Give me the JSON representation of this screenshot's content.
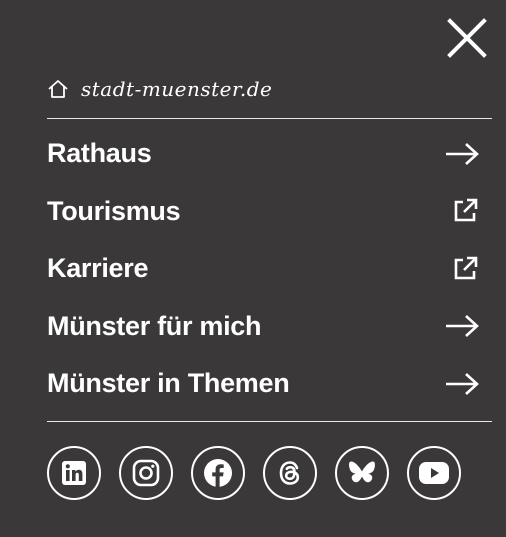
{
  "header": {
    "home_label": "stadt-muenster.de",
    "close_icon": "close-icon"
  },
  "nav": {
    "items": [
      {
        "label": "Rathaus",
        "icon": "arrow-right-icon"
      },
      {
        "label": "Tourismus",
        "icon": "external-link-icon"
      },
      {
        "label": "Karriere",
        "icon": "external-link-icon"
      },
      {
        "label": "Münster für mich",
        "icon": "arrow-right-icon"
      },
      {
        "label": "Münster in Themen",
        "icon": "arrow-right-icon"
      }
    ]
  },
  "social": {
    "items": [
      {
        "icon": "linkedin-icon"
      },
      {
        "icon": "instagram-icon"
      },
      {
        "icon": "facebook-icon"
      },
      {
        "icon": "threads-icon"
      },
      {
        "icon": "bluesky-icon"
      },
      {
        "icon": "youtube-icon"
      }
    ]
  },
  "colors": {
    "background": "#3a3839",
    "foreground": "#ffffff"
  }
}
